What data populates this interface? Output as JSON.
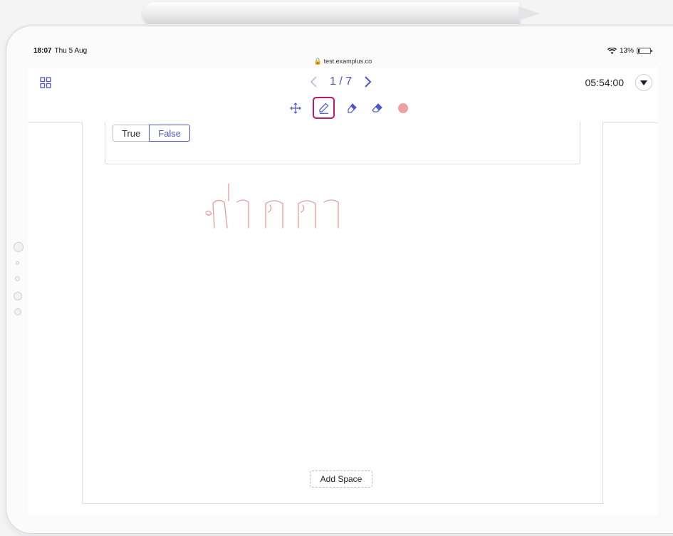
{
  "status_bar": {
    "time": "18:07",
    "date": "Thu 5 Aug",
    "url": "test.examplus.co",
    "battery": "13%"
  },
  "header": {
    "page_indicator": "1 / 7",
    "timer": "05:54:00"
  },
  "toolbar": {
    "tools": [
      "move-icon",
      "pen-icon",
      "highlighter-icon",
      "eraser-icon",
      "color-dot"
    ],
    "active_tool": "pen",
    "pen_color": "#eda0a0",
    "accent_color": "#4b57c9",
    "active_border_color": "#c0166f"
  },
  "question": {
    "options": [
      "True",
      "False"
    ],
    "selected": "False"
  },
  "handwriting": {
    "text": "ปากกา",
    "color": "#e89a9a"
  },
  "footer": {
    "add_space_label": "Add Space"
  }
}
